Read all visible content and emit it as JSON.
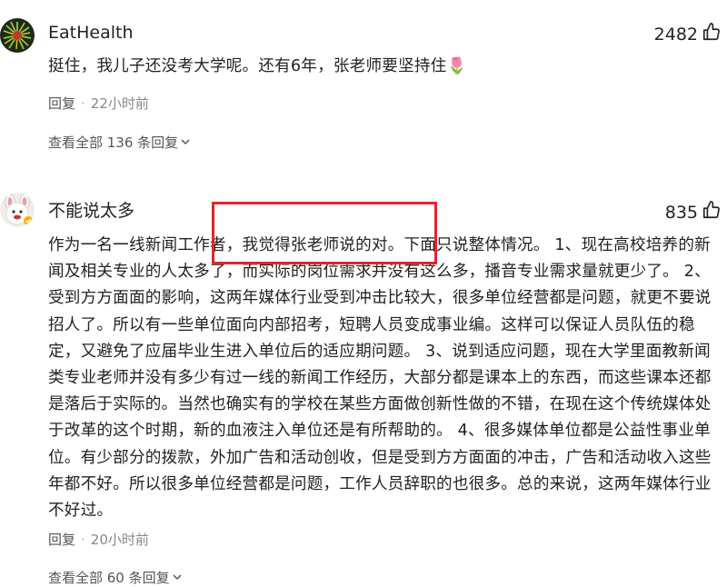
{
  "comments": [
    {
      "username": "EatHealth",
      "likes": "2482",
      "text": "挺住，我儿子还没考大学呢。还有6年，张老师要坚持住🌷",
      "reply_label": "回复",
      "time": "22小时前",
      "view_all": "查看全部 136 条回复"
    },
    {
      "username": "不能说太多",
      "likes": "835",
      "text": "作为一名一线新闻工作者，我觉得张老师说的对。下面只说整体情况。 1、现在高校培养的新闻及相关专业的人太多了，而实际的岗位需求并没有这么多，播音专业需求量就更少了。 2、受到方方面面的影响，这两年媒体行业受到冲击比较大，很多单位经营都是问题，就更不要说招人了。所以有一些单位面向内部招考，短聘人员变成事业编。这样可以保证人员队伍的稳定，又避免了应届毕业生进入单位后的适应期问题。 3、说到适应问题，现在大学里面教新闻类专业老师并没有多少有过一线的新闻工作经历，大部分都是课本上的东西，而这些课本还都是落后于实际的。当然也确实有的学校在某些方面做创新性做的不错，在现在这个传统媒体处于改革的这个时期，新的血液注入单位还是有所帮助的。 4、很多媒体单位都是公益性事业单位。有少部分的拨款，外加广告和活动创收，但是受到方方面面的冲击，广告和活动收入这些年都不好。所以很多单位经营都是问题，工作人员辞职的也很多。总的来说，这两年媒体行业不好过。",
      "reply_label": "回复",
      "time": "20小时前",
      "view_all": "查看全部 60 条回复"
    }
  ],
  "colors": {
    "highlight_box": "#e0262e",
    "text": "#222222",
    "meta": "#888888"
  }
}
